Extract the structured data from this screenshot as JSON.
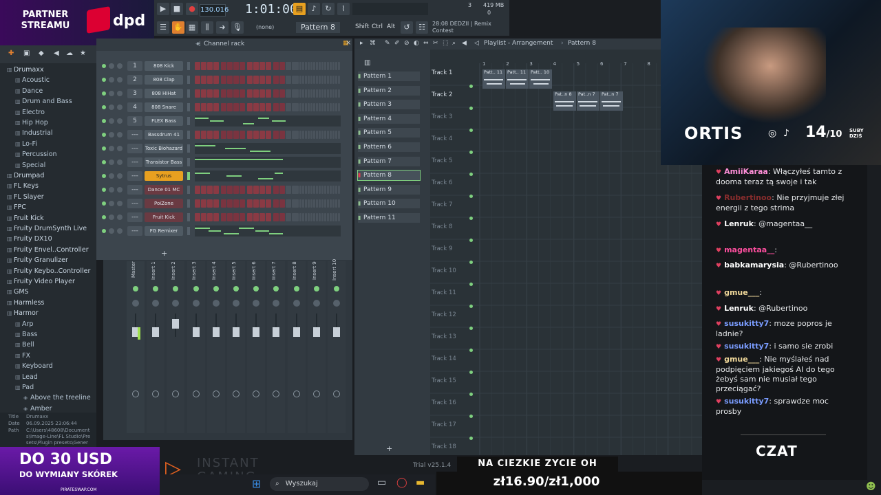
{
  "partner": {
    "line1": "PARTNER",
    "line2": "STREAMU",
    "brand": "dpd"
  },
  "toolbar": {
    "tempo": "130.016",
    "time": "1:01:00",
    "pattern": "Pattern 8",
    "none": "(none)",
    "shift": "Shift",
    "ctrl": "Ctrl",
    "alt": "Alt",
    "cpu": "419 MB",
    "cpu_num": "3",
    "cpu_zero": "0",
    "hint_line1": "28:08 DEDZII | Remix",
    "hint_line2": "Contest"
  },
  "browser": {
    "items": [
      {
        "label": "Drumaxx",
        "indent": 0
      },
      {
        "label": "Acoustic",
        "indent": 1
      },
      {
        "label": "Dance",
        "indent": 1
      },
      {
        "label": "Drum and Bass",
        "indent": 1
      },
      {
        "label": "Electro",
        "indent": 1
      },
      {
        "label": "Hip Hop",
        "indent": 1
      },
      {
        "label": "Industrial",
        "indent": 1
      },
      {
        "label": "Lo-Fi",
        "indent": 1
      },
      {
        "label": "Percussion",
        "indent": 1
      },
      {
        "label": "Special",
        "indent": 1
      },
      {
        "label": "Drumpad",
        "indent": 0
      },
      {
        "label": "FL Keys",
        "indent": 0
      },
      {
        "label": "FL Slayer",
        "indent": 0
      },
      {
        "label": "FPC",
        "indent": 0
      },
      {
        "label": "Fruit Kick",
        "indent": 0
      },
      {
        "label": "Fruity DrumSynth Live",
        "indent": 0
      },
      {
        "label": "Fruity DX10",
        "indent": 0
      },
      {
        "label": "Fruity Envel..Controller",
        "indent": 0
      },
      {
        "label": "Fruity Granulizer",
        "indent": 0
      },
      {
        "label": "Fruity Keybo..Controller",
        "indent": 0
      },
      {
        "label": "Fruity Video Player",
        "indent": 0
      },
      {
        "label": "GMS",
        "indent": 0
      },
      {
        "label": "Harmless",
        "indent": 0
      },
      {
        "label": "Harmor",
        "indent": 0
      },
      {
        "label": "Arp",
        "indent": 1
      },
      {
        "label": "Bass",
        "indent": 1
      },
      {
        "label": "Bell",
        "indent": 1
      },
      {
        "label": "FX",
        "indent": 1
      },
      {
        "label": "Keyboard",
        "indent": 1
      },
      {
        "label": "Lead",
        "indent": 1
      },
      {
        "label": "Pad",
        "indent": 1
      },
      {
        "label": "Above the treeline",
        "indent": 2
      },
      {
        "label": "Amber",
        "indent": 2
      }
    ],
    "info_title_label": "Title",
    "info_title": "Drumaxx",
    "info_date_label": "Date",
    "info_date": "06.09.2025 23:06:44",
    "info_path_label": "Path",
    "info_path": "C:\\Users\\48608\\Documents\\Image-Line\\FL Studio\\Presets\\Plugin presets\\Generat"
  },
  "rack": {
    "title": "Channel rack",
    "channels": [
      {
        "num": "1",
        "name": "808 Kick",
        "kind": "steps"
      },
      {
        "num": "2",
        "name": "808 Clap",
        "kind": "steps"
      },
      {
        "num": "3",
        "name": "808 HiHat",
        "kind": "steps"
      },
      {
        "num": "4",
        "name": "808 Snare",
        "kind": "steps"
      },
      {
        "num": "5",
        "name": "FLEX Bass",
        "kind": "roll"
      },
      {
        "num": "---",
        "name": "Bassdrum 41",
        "kind": "steps"
      },
      {
        "num": "---",
        "name": "Toxic Biohazard",
        "kind": "roll"
      },
      {
        "num": "---",
        "name": "Transistor Bass",
        "kind": "roll"
      },
      {
        "num": "---",
        "name": "Sytrus",
        "kind": "roll",
        "selected": true
      },
      {
        "num": "---",
        "name": "Dance 01  MC",
        "kind": "steps"
      },
      {
        "num": "---",
        "name": "PoiZone",
        "kind": "steps"
      },
      {
        "num": "---",
        "name": "Fruit Kick",
        "kind": "steps"
      },
      {
        "num": "---",
        "name": "FG Remixer",
        "kind": "roll"
      }
    ]
  },
  "mixer": {
    "tracks": [
      "Master",
      "Insert 1",
      "Insert 2",
      "Insert 3",
      "Insert 4",
      "Insert 5",
      "Insert 6",
      "Insert 7",
      "Insert 8",
      "Insert 9",
      "Insert 10"
    ]
  },
  "patterns": [
    "Pattern 1",
    "Pattern 2",
    "Pattern 3",
    "Pattern 4",
    "Pattern 5",
    "Pattern 6",
    "Pattern 7",
    "Pattern 8",
    "Pattern 9",
    "Pattern 10",
    "Pattern 11"
  ],
  "playlist": {
    "title": "Playlist - Arrangement",
    "pattern": "Pattern 8",
    "bar_numbers": [
      "1",
      "2",
      "3",
      "4",
      "5",
      "6",
      "7",
      "8"
    ],
    "tracks": [
      "Track 1",
      "Track 2",
      "Track 3",
      "Track 4",
      "Track 5",
      "Track 6",
      "Track 7",
      "Track 8",
      "Track 9",
      "Track 10",
      "Track 11",
      "Track 12",
      "Track 13",
      "Track 14",
      "Track 15",
      "Track 16",
      "Track 17",
      "Track 18"
    ],
    "clips1": [
      "Patt.. 11",
      "Patt.. 11",
      "Patt.. 10"
    ],
    "clips2": [
      "Pat..n 8",
      "Pat..n 7",
      "Pat..n 7"
    ]
  },
  "stream": {
    "name": "ORTIS",
    "subs": "14",
    "subs_goal": "/10",
    "subs_label1": "SUBY",
    "subs_label2": "DZIŚ"
  },
  "chat": {
    "messages": [
      {
        "user": "AmiiKaraa",
        "color": "#ff8fd8",
        "text": "Włączyłeś tamto z dooma teraz tą swoje i tak"
      },
      {
        "user": "Rubertinoo",
        "color": "#8a2d2d",
        "text": "Nie przyjmuje złej energii z tego strima"
      },
      {
        "user": "Lenruk",
        "color": "#ffffff",
        "text": "@magentaa__"
      },
      {
        "user": "magentaa__",
        "color": "#ff4fa0",
        "text": ""
      },
      {
        "user": "babkamarysia",
        "color": "#ffffff",
        "text": "@Rubertinoo"
      },
      {
        "user": "gmue___",
        "color": "#f0d89a",
        "text": ""
      },
      {
        "user": "Lenruk",
        "color": "#ffffff",
        "text": "@Rubertinoo"
      },
      {
        "user": "susukitty7",
        "color": "#7a9cff",
        "text": "moze popros je ladnie?"
      },
      {
        "user": "susukitty7",
        "color": "#7a9cff",
        "text": "i samo sie zrobi"
      },
      {
        "user": "gmue___",
        "color": "#f0d89a",
        "text": "Nie myślałeś nad podpięciem jakiegoś AI do tego żebyś sam nie musiał tego przeciągać?"
      },
      {
        "user": "susukitty7",
        "color": "#7a9cff",
        "text": "sprawdze moc prosby"
      }
    ],
    "label": "CZAT"
  },
  "promo": {
    "big": "DO 30 USD",
    "small": "DO WYMIANY SKÓREK",
    "url": "PIRATESWAP.COM"
  },
  "instant": {
    "line1": "INSTANT",
    "line2": "GAMING"
  },
  "taskbar": {
    "search": "Wyszukaj"
  },
  "trial": "Trial v25.1.4",
  "donation": {
    "title": "NA CIEZKIE ZYCIE OH",
    "amount": "zł16.90/zł1,000"
  }
}
